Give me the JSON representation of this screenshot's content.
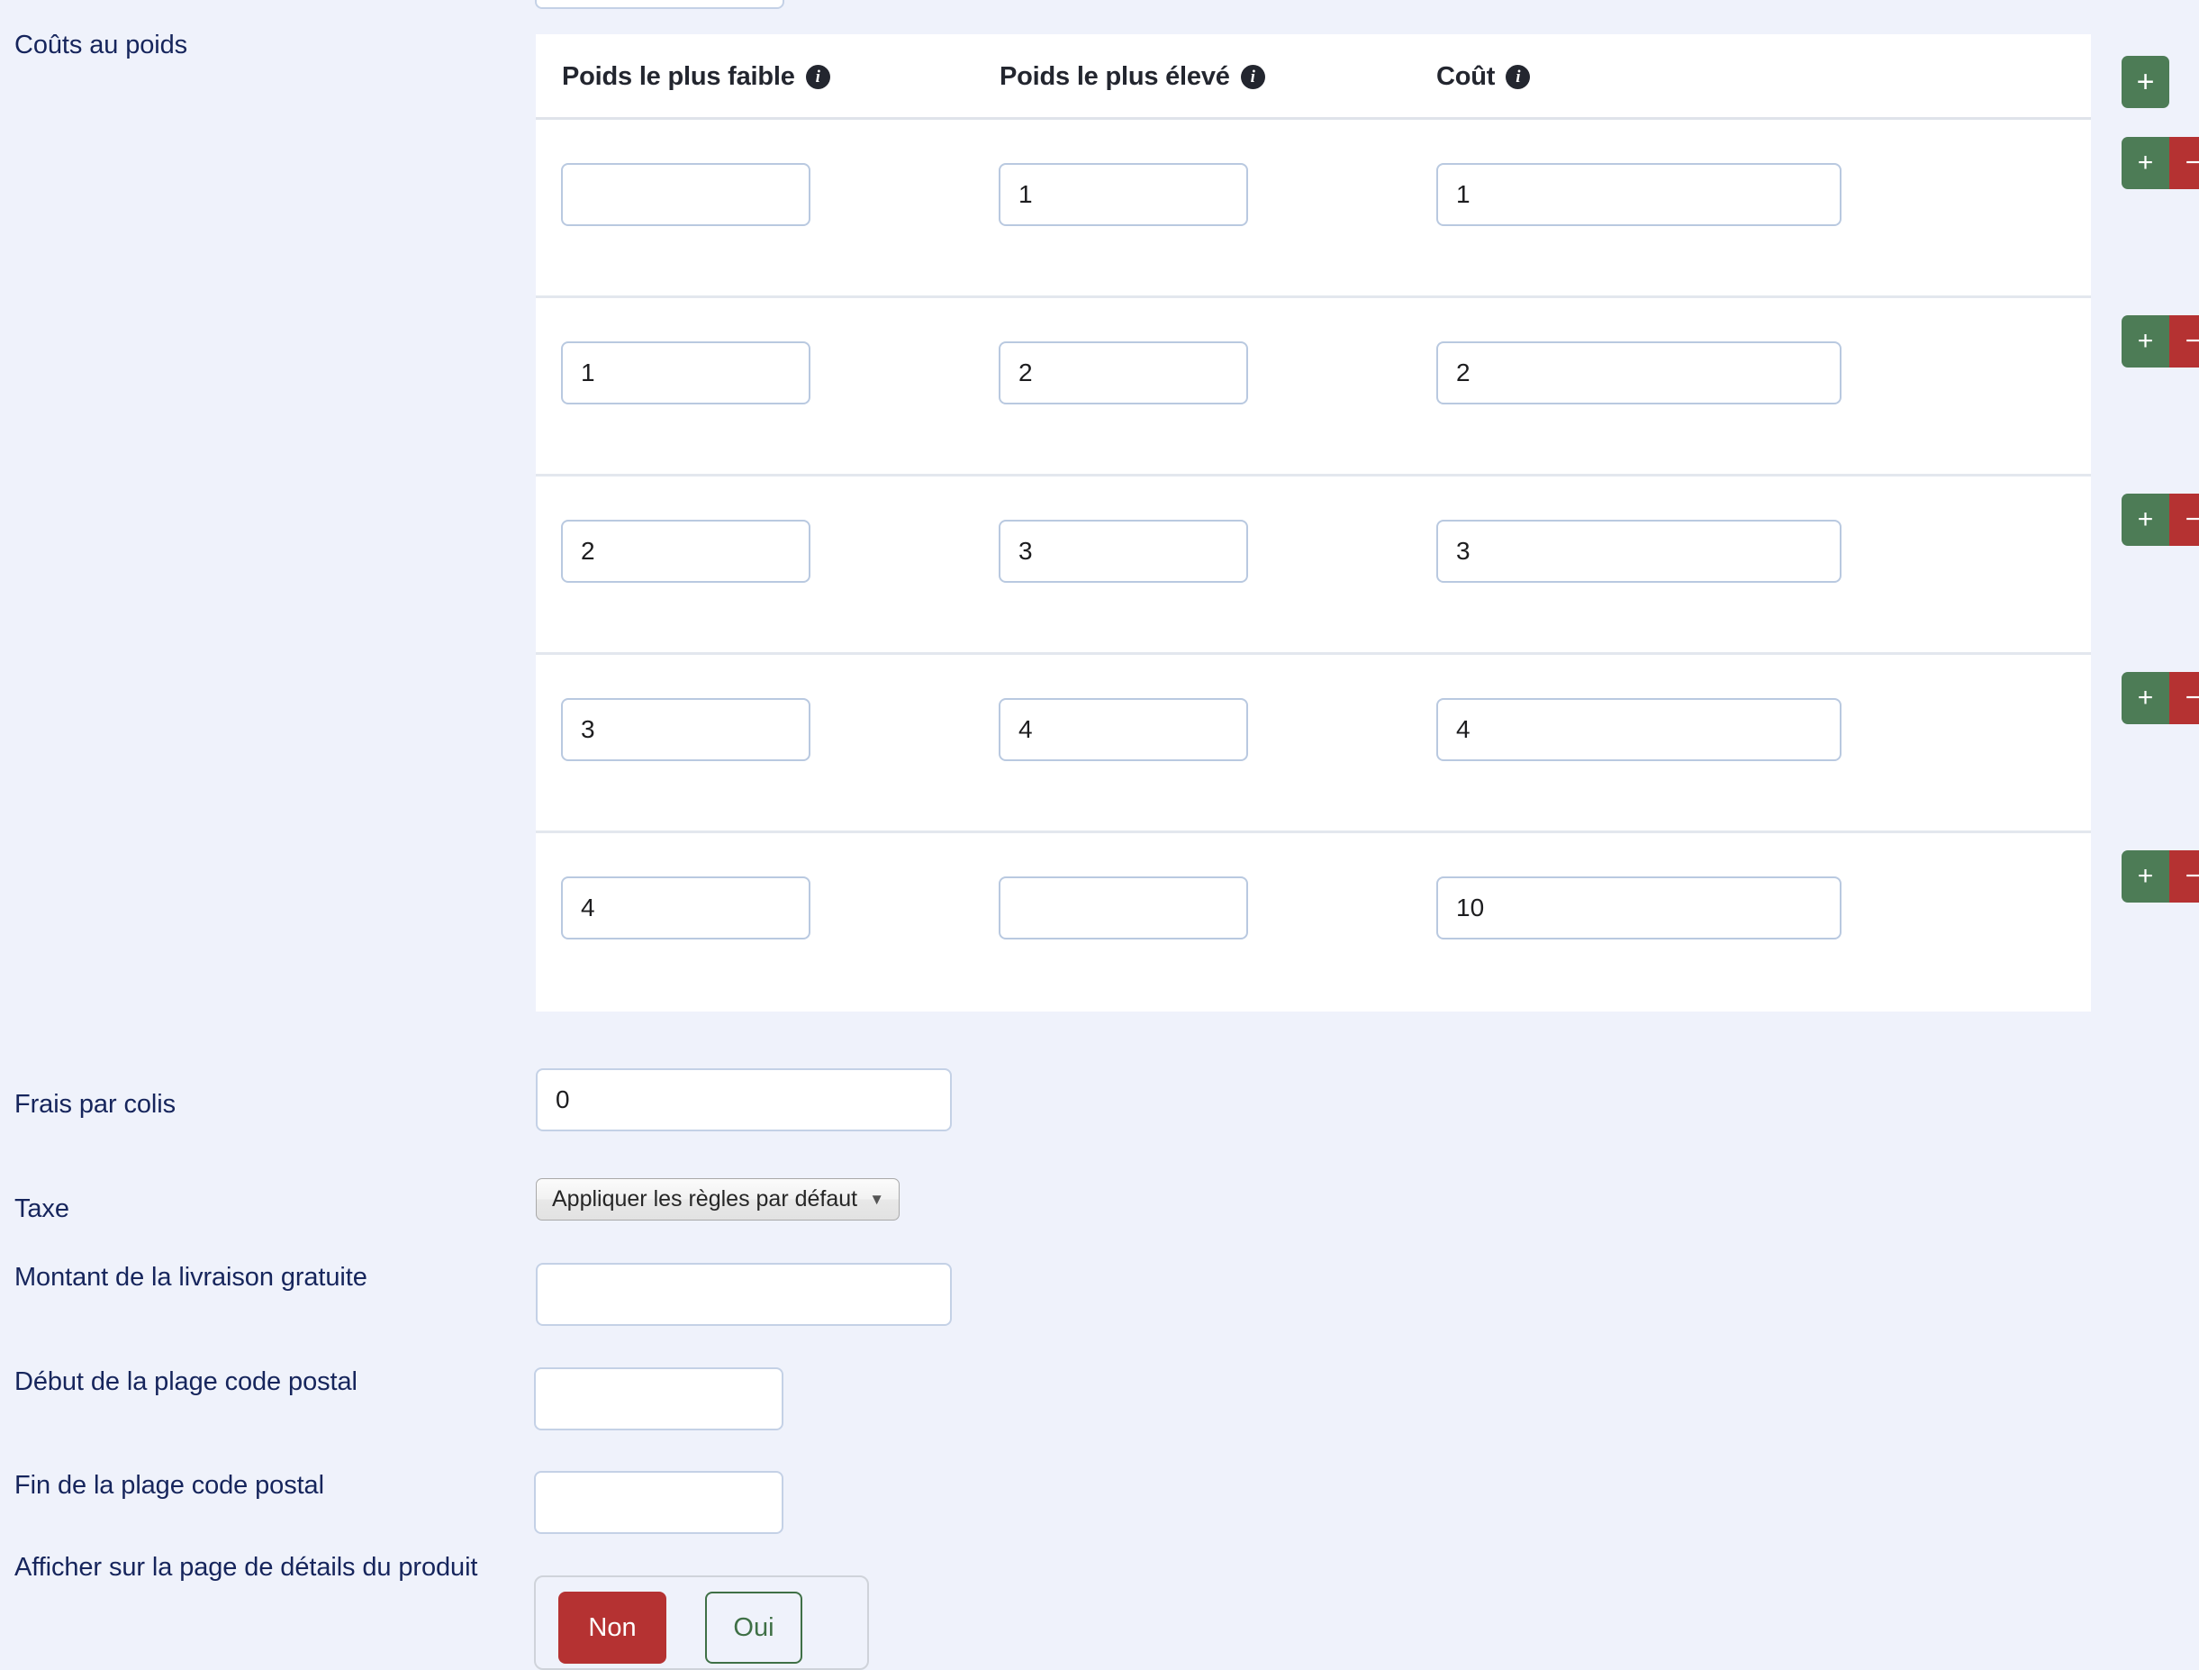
{
  "weight_costs": {
    "section_label": "Coûts au poids",
    "columns": [
      {
        "label": "Poids le plus faible",
        "info_icon": "info-icon"
      },
      {
        "label": "Poids le plus élevé",
        "info_icon": "info-icon"
      },
      {
        "label": "Coût",
        "info_icon": "info-icon"
      }
    ],
    "header_add_label": "+",
    "row_actions": {
      "add_label": "+",
      "remove_label": "−",
      "move_icon": "move-arrows-icon"
    },
    "rows": [
      {
        "lowest_weight": "",
        "highest_weight": "1",
        "cost": "1"
      },
      {
        "lowest_weight": "1",
        "highest_weight": "2",
        "cost": "2"
      },
      {
        "lowest_weight": "2",
        "highest_weight": "3",
        "cost": "3"
      },
      {
        "lowest_weight": "3",
        "highest_weight": "4",
        "cost": "4"
      },
      {
        "lowest_weight": "4",
        "highest_weight": "",
        "cost": "10"
      }
    ]
  },
  "fields": {
    "per_package_fee": {
      "label": "Frais par colis",
      "value": "0"
    },
    "tax": {
      "label": "Taxe",
      "selected": "Appliquer les règles par défaut",
      "caret_icon": "chevron-down-icon"
    },
    "free_shipping_amount": {
      "label": "Montant de la livraison gratuite",
      "value": ""
    },
    "zip_range_start": {
      "label": "Début de la plage code postal",
      "value": ""
    },
    "zip_range_end": {
      "label": "Fin de la plage code postal",
      "value": ""
    },
    "show_on_product_page": {
      "label": "Afficher sur la page de détails du produit",
      "no_label": "Non",
      "yes_label": "Oui",
      "selected": "Non"
    }
  },
  "colors": {
    "page_background": "#eff2fb",
    "panel_background": "#ffffff",
    "label_text": "#16255c",
    "add_green": "#4d7c56",
    "remove_red": "#b53232",
    "move_blue": "#41618f",
    "info_dark": "#23262f",
    "toggle_active_red": "#b53232",
    "toggle_yes_green": "#3f7046"
  }
}
